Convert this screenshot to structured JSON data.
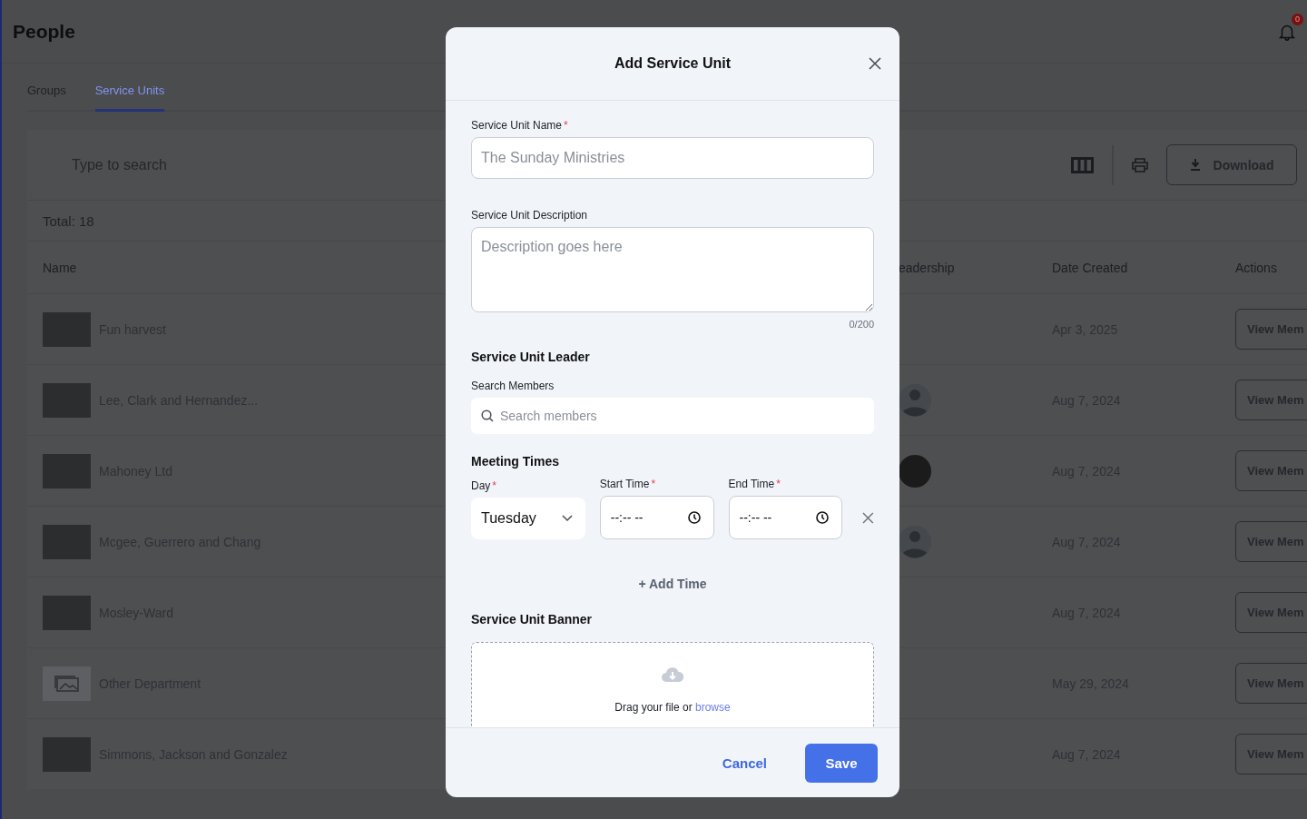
{
  "page": {
    "title": "People",
    "notification_count": "0"
  },
  "tabs": [
    {
      "label": "Groups",
      "selected": false
    },
    {
      "label": "Service Units",
      "selected": true
    }
  ],
  "toolbar": {
    "search_placeholder": "Type to search",
    "download_label": "Download"
  },
  "total": "Total: 18",
  "table": {
    "columns": [
      "Name",
      "eadership",
      "Date Created",
      "Actions"
    ],
    "rows": [
      {
        "name": "Fun harvest",
        "thumb": {
          "kind": "photo"
        },
        "date": "Apr 3, 2025",
        "action": "View Mem"
      },
      {
        "name": "Lee, Clark and Hernandez...",
        "thumb": {
          "kind": "photo"
        },
        "leader": {
          "kind": "silhouette"
        },
        "date": "Aug 7, 2024",
        "action": "View Mem"
      },
      {
        "name": "Mahoney Ltd",
        "thumb": {
          "kind": "photo"
        },
        "leader": {
          "kind": "photo"
        },
        "date": "Aug 7, 2024",
        "action": "View Mem"
      },
      {
        "name": "Mcgee, Guerrero and Chang",
        "thumb": {
          "kind": "photo"
        },
        "leader": {
          "kind": "silhouette"
        },
        "date": "Aug 7, 2024",
        "action": "View Mem"
      },
      {
        "name": "Mosley-Ward",
        "thumb": {
          "kind": "photo"
        },
        "date": "Aug 7, 2024",
        "action": "View Mem"
      },
      {
        "name": "Other Department",
        "thumb": {
          "kind": "placeholder"
        },
        "date": "May 29, 2024",
        "action": "View Mem"
      },
      {
        "name": "Simmons, Jackson and Gonzalez",
        "thumb": {
          "kind": "photo"
        },
        "date": "Aug 7, 2024",
        "action": "View Mem"
      }
    ]
  },
  "modal": {
    "title": "Add Service Unit",
    "name_field": {
      "label": "Service Unit Name",
      "required_mark": "*",
      "placeholder": "The Sunday Ministries"
    },
    "description_field": {
      "label": "Service Unit Description",
      "placeholder": "Description goes here",
      "counter": "0/200"
    },
    "leader": {
      "heading": "Service Unit Leader",
      "label": "Search Members",
      "placeholder": "Search members"
    },
    "meeting_times": {
      "heading": "Meeting Times",
      "rows": [
        {
          "day_label": "Day",
          "day_mark": "*",
          "day": "Tuesday",
          "start_label": "Start Time",
          "start_mark": "*",
          "start_value": "--:-- --",
          "end_label": "End Time",
          "end_mark": "*",
          "end_value": "--:-- --"
        }
      ],
      "add_label": "+ Add Time"
    },
    "banner": {
      "heading": "Service Unit Banner",
      "prompt": "Drag your file or",
      "link": "browse"
    },
    "buttons": {
      "cancel": "Cancel",
      "save": "Save"
    }
  }
}
